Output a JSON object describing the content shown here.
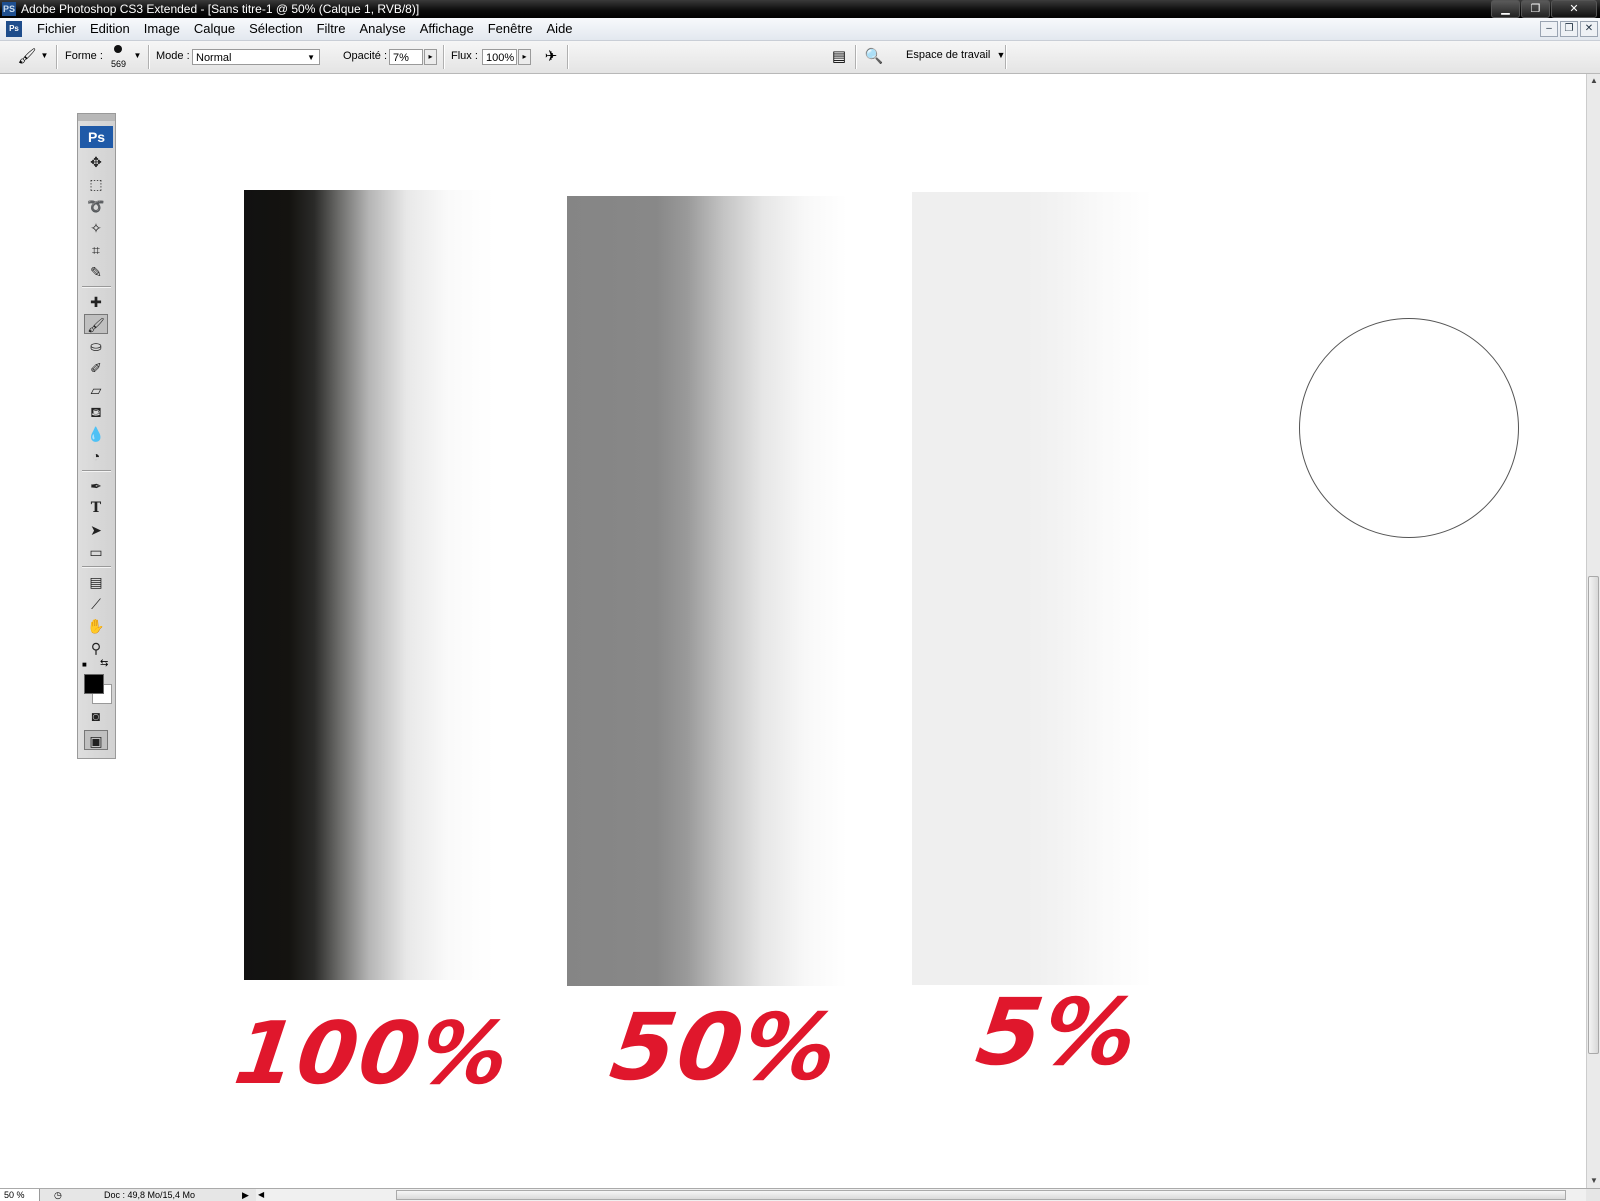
{
  "window": {
    "title": "Adobe Photoshop CS3 Extended - [Sans titre-1 @ 50% (Calque 1, RVB/8)]",
    "app_icon": "PS",
    "controls": [
      "minimize-icon",
      "restore-icon",
      "close-icon"
    ]
  },
  "menubar": {
    "items": [
      "Fichier",
      "Edition",
      "Image",
      "Calque",
      "Sélection",
      "Filtre",
      "Analyse",
      "Affichage",
      "Fenêtre",
      "Aide"
    ],
    "doc_icon": "Ps"
  },
  "options": {
    "forme_label": "Forme :",
    "brush_size": "569",
    "mode_label": "Mode :",
    "mode_value": "Normal",
    "opacity_label": "Opacité :",
    "opacity_value": "7%",
    "flux_label": "Flux :",
    "flux_value": "100%",
    "workspace_label": "Espace de travail"
  },
  "canvas": {
    "labels": [
      "100%",
      "50%",
      "5%"
    ],
    "ink_color": "#e0172c"
  },
  "toolbox": {
    "badge": "Ps",
    "tools": [
      "move-icon",
      "marquee-icon",
      "lasso-icon",
      "magic-wand-icon",
      "crop-icon",
      "slice-icon",
      "healing-brush-icon",
      "brush-icon",
      "clone-stamp-icon",
      "history-brush-icon",
      "eraser-icon",
      "paint-bucket-icon",
      "blur-icon",
      "dodge-icon",
      "pen-icon",
      "type-icon",
      "path-selection-icon",
      "rectangle-icon",
      "notes-icon",
      "eyedropper-icon",
      "hand-icon",
      "zoom-icon"
    ],
    "foreground_color": "#000000",
    "background_color": "#ffffff"
  },
  "status": {
    "zoom": "50 %",
    "doc": "Doc : 49,8 Mo/15,4 Mo"
  }
}
